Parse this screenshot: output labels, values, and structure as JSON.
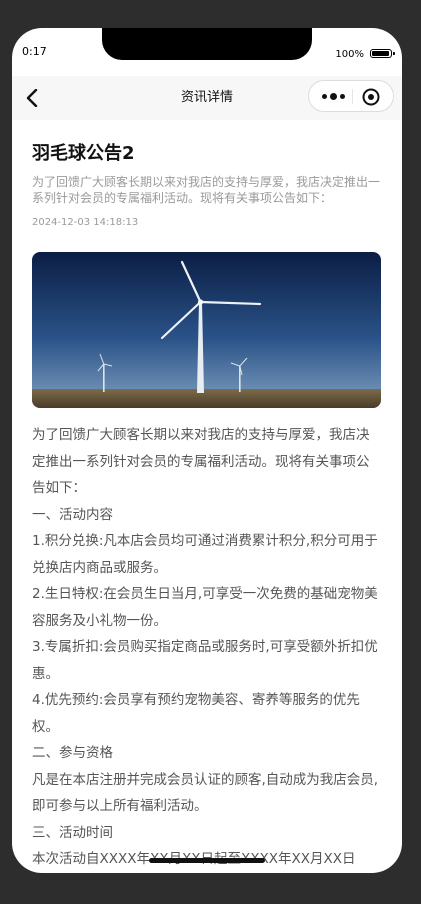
{
  "status_bar": {
    "time": "0:17",
    "battery_percent": "100%"
  },
  "navbar": {
    "title": "资讯详情",
    "back_icon": "chevron-left-icon",
    "more_icon": "more-dots-icon",
    "close_icon": "target-circle-icon"
  },
  "article": {
    "title": "羽毛球公告2",
    "summary": "为了回馈广大顾客长期以来对我店的支持与厚爱，我店决定推出一系列针对会员的专属福利活动。现将有关事项公告如下：",
    "time": "2024-12-03 14:18:13",
    "image": "wind-turbines-photo",
    "paragraphs": [
      "为了回馈广大顾客长期以来对我店的支持与厚爱，我店决定推出一系列针对会员的专属福利活动。现将有关事项公告如下：",
      "一、活动内容",
      "1.积分兑换:凡本店会员均可通过消费累计积分,积分可用于兑换店内商品或服务。",
      "2.生日特权:在会员生日当月,可享受一次免费的基础宠物美容服务及小礼物一份。",
      "3.专属折扣:会员购买指定商品或服务时,可享受额外折扣优惠。",
      "4.优先预约:会员享有预约宠物美容、寄养等服务的优先权。",
      "二、参与资格",
      "凡是在本店注册并完成会员认证的顾客,自动成为我店会员,即可参与以上所有福利活动。",
      "三、活动时间",
      "本次活动自XXXX年XX月XX日起至XXXX年XX月XX日"
    ]
  },
  "colors": {
    "page_bg": "#2d2d2d",
    "navbar_bg": "#f7f7f7",
    "summary_text": "#9a9a9a",
    "body_text": "#555555"
  }
}
